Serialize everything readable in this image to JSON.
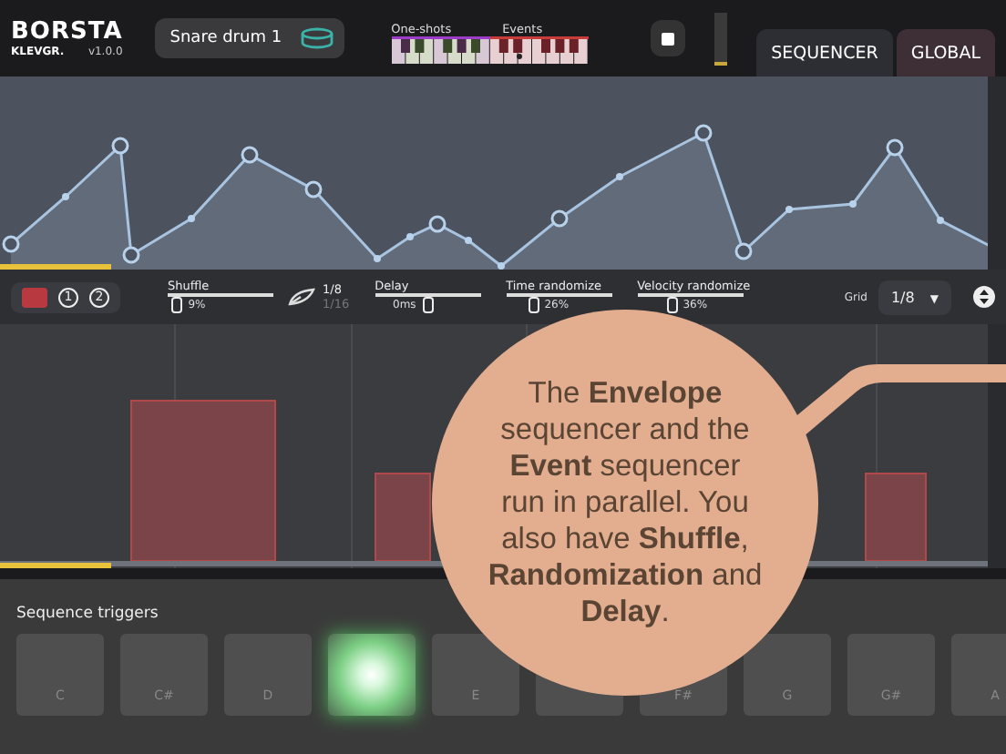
{
  "header": {
    "logo": "BORSTA",
    "brand": "KLEVGR.",
    "version": "v1.0.0",
    "preset": "Snare drum 1",
    "keyboard_labels": [
      "One-shots",
      "Events"
    ],
    "tabs": [
      {
        "label": "SEQUENCER",
        "selected": true
      },
      {
        "label": "GLOBAL",
        "selected": false
      }
    ]
  },
  "controls": {
    "lanes": [
      {
        "label": "1",
        "selected": false
      },
      {
        "label": "2",
        "selected": false
      }
    ],
    "sliders": [
      {
        "label": "Shuffle",
        "reading": "9%",
        "level": 0.09
      },
      {
        "kind": "grid-options",
        "options": [
          {
            "label": "1/8",
            "selected": true
          },
          {
            "label": "1/16",
            "selected": false
          }
        ]
      },
      {
        "kind": "reading-first",
        "label": "Delay",
        "reading": "0ms",
        "level": 0.55
      },
      {
        "label": "Time randomize",
        "reading": "26%",
        "level": 0.26
      },
      {
        "label": "Velocity randomize",
        "reading": "36%",
        "level": 0.33
      }
    ],
    "grid_label": "Grid",
    "grid_value": "1/8",
    "grid_caret": "▼"
  },
  "triggers": {
    "title": "Sequence triggers",
    "pads": [
      {
        "label": "C",
        "active": false
      },
      {
        "label": "C#",
        "active": false
      },
      {
        "label": "D",
        "active": false
      },
      {
        "active": true
      },
      {
        "label": "E",
        "active": false
      },
      {
        "active": false
      },
      {
        "label": "F#",
        "active": false
      },
      {
        "label": "G",
        "active": false
      },
      {
        "label": "G#",
        "active": false
      },
      {
        "label": "A",
        "active": false
      }
    ]
  },
  "callout": {
    "text": "The **Envelope** sequencer and the **Event** sequencer run in parallel. You also have **Shuffle**, **Randomization** and **Delay**."
  }
}
